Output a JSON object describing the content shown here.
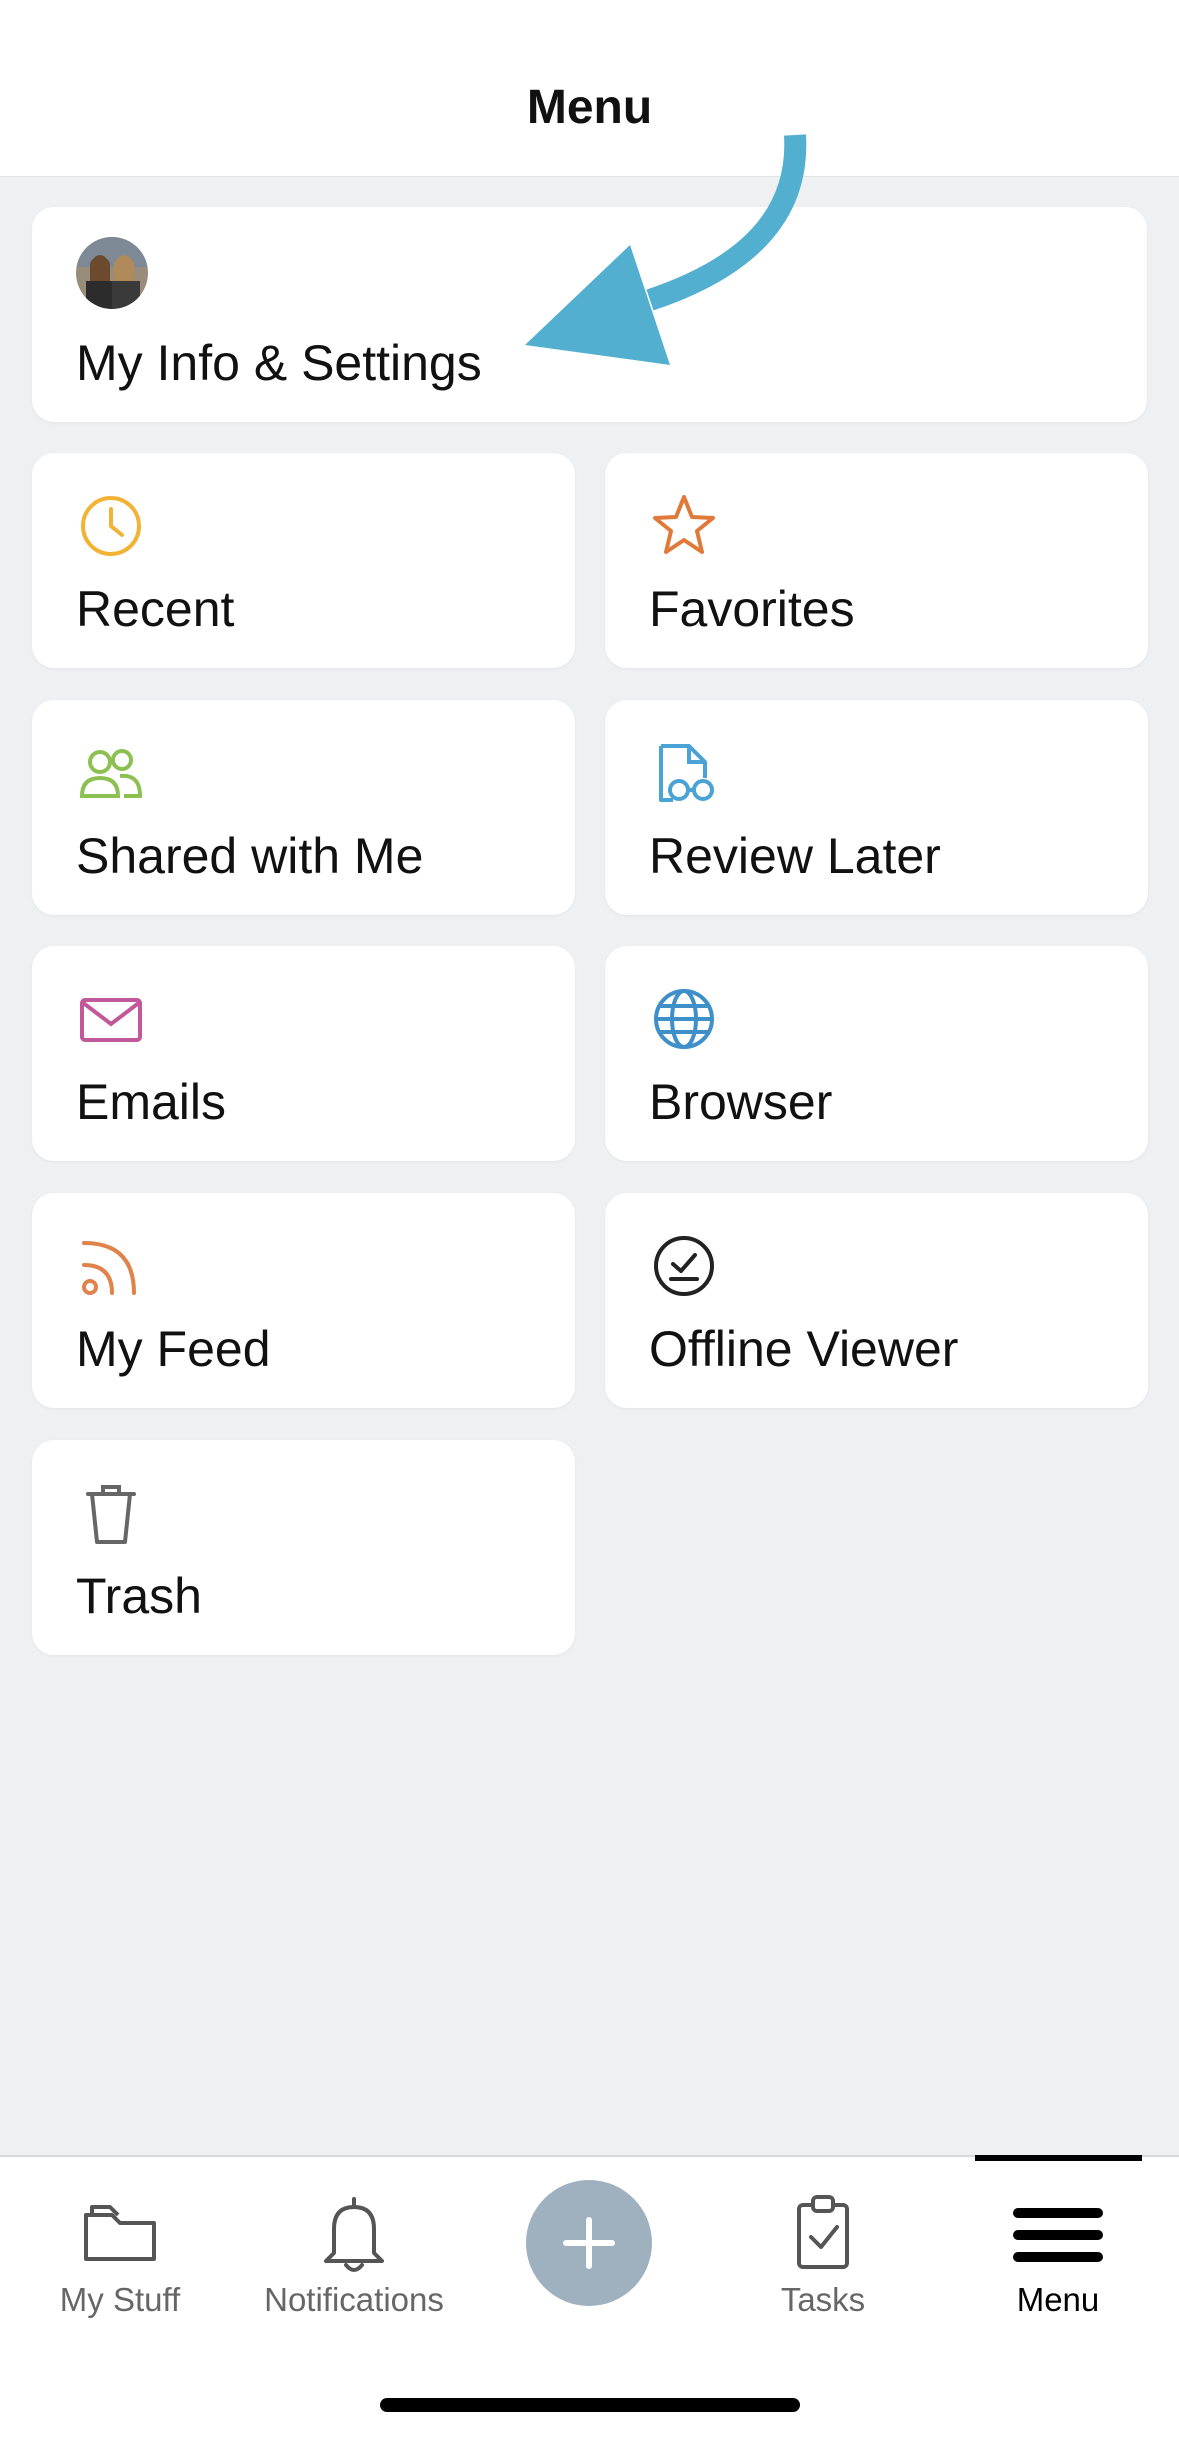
{
  "header": {
    "title": "Menu"
  },
  "profile": {
    "label": "My Info & Settings",
    "avatar": "profile-photo"
  },
  "items": [
    {
      "label": "Recent",
      "icon": "clock-icon",
      "color": "#f2b233"
    },
    {
      "label": "Favorites",
      "icon": "star-icon",
      "color": "#e07a3a"
    },
    {
      "label": "Shared with Me",
      "icon": "people-icon",
      "color": "#8cc152"
    },
    {
      "label": "Review Later",
      "icon": "document-glasses-icon",
      "color": "#4aa3d4"
    },
    {
      "label": "Emails",
      "icon": "envelope-icon",
      "color": "#c0589a"
    },
    {
      "label": "Browser",
      "icon": "globe-icon",
      "color": "#3f8fc9"
    },
    {
      "label": "My Feed",
      "icon": "rss-icon",
      "color": "#e0834a"
    },
    {
      "label": "Offline Viewer",
      "icon": "offline-check-icon",
      "color": "#222222"
    },
    {
      "label": "Trash",
      "icon": "trash-icon",
      "color": "#666666"
    }
  ],
  "tabbar": {
    "tabs": [
      {
        "label": "My Stuff",
        "icon": "folder-icon"
      },
      {
        "label": "Notifications",
        "icon": "bell-icon"
      },
      {
        "label": "Tasks",
        "icon": "clipboard-check-icon"
      },
      {
        "label": "Menu",
        "icon": "hamburger-icon",
        "active": true
      }
    ],
    "add_button": "plus-icon"
  },
  "annotation": {
    "arrow_color": "#52afd0"
  }
}
